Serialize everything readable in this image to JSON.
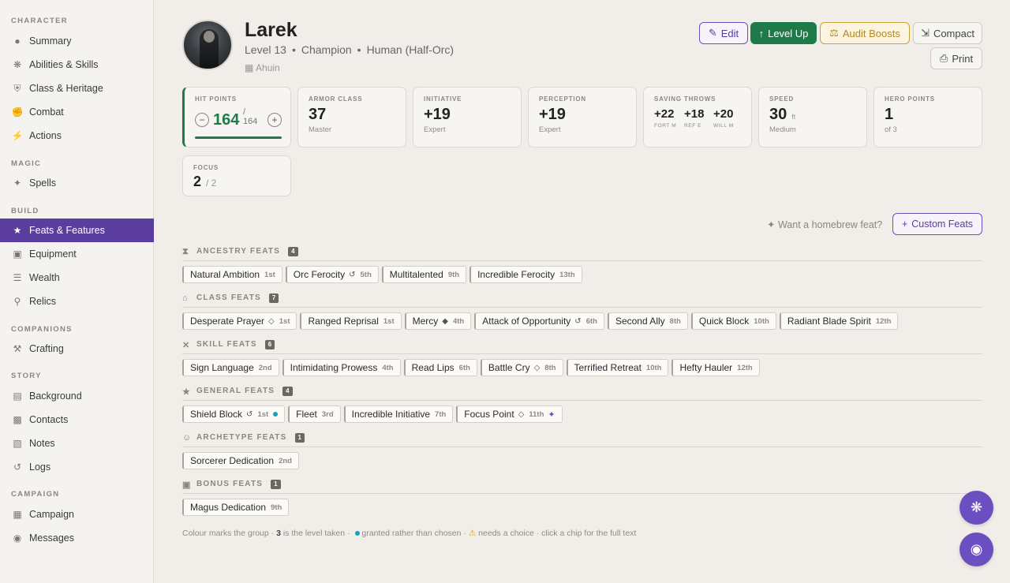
{
  "sidebar": {
    "sections": {
      "character": "CHARACTER",
      "magic": "MAGIC",
      "build": "BUILD",
      "companions": "COMPANIONS",
      "story": "STORY",
      "campaign": "CAMPAIGN"
    },
    "items": {
      "summary": "Summary",
      "abilities": "Abilities & Skills",
      "class": "Class & Heritage",
      "combat": "Combat",
      "actions": "Actions",
      "spells": "Spells",
      "feats": "Feats & Features",
      "equipment": "Equipment",
      "wealth": "Wealth",
      "relics": "Relics",
      "crafting": "Crafting",
      "background": "Background",
      "contacts": "Contacts",
      "notes": "Notes",
      "logs": "Logs",
      "campaign": "Campaign",
      "messages": "Messages"
    },
    "active_color": "#5b3d9e"
  },
  "header": {
    "name": "Larek",
    "level": "Level 13",
    "class": "Champion",
    "ancestry": "Human (Half-Orc)",
    "owner": "Ahuin",
    "buttons": {
      "edit": "Edit",
      "level_up": "Level Up",
      "audit": "Audit Boosts",
      "compact": "Compact",
      "print": "Print"
    }
  },
  "stats": {
    "hp": {
      "label": "HIT POINTS",
      "current": "164",
      "max": "164",
      "minus": "−",
      "plus": "+"
    },
    "ac": {
      "label": "ARMOR CLASS",
      "value": "37",
      "sub": "Master"
    },
    "initiative": {
      "label": "INITIATIVE",
      "value": "+19",
      "sub": "Expert"
    },
    "perception": {
      "label": "PERCEPTION",
      "value": "+19",
      "sub": "Expert"
    },
    "saves": {
      "label": "SAVING THROWS",
      "fort": {
        "value": "+22",
        "label": "FORT M"
      },
      "ref": {
        "value": "+18",
        "label": "REF E"
      },
      "will": {
        "value": "+20",
        "label": "WILL M"
      }
    },
    "speed": {
      "label": "SPEED",
      "value": "30",
      "unit": "ft",
      "sub": "Medium"
    },
    "hero": {
      "label": "HERO POINTS",
      "value": "1",
      "sub": "of 3"
    },
    "focus": {
      "label": "FOCUS",
      "value": "2",
      "max": "/ 2"
    }
  },
  "homebrew": {
    "prompt": "Want a homebrew feat?",
    "button": "Custom Feats"
  },
  "feat_groups": [
    {
      "title": "ANCESTRY FEATS",
      "count": "4",
      "feats": [
        {
          "name": "Natural Ambition",
          "level": "1st"
        },
        {
          "name": "Orc Ferocity",
          "level": "5th",
          "action": "↺"
        },
        {
          "name": "Multitalented",
          "level": "9th"
        },
        {
          "name": "Incredible Ferocity",
          "level": "13th"
        }
      ]
    },
    {
      "title": "CLASS FEATS",
      "count": "7",
      "feats": [
        {
          "name": "Desperate Prayer",
          "level": "1st",
          "action": "◇"
        },
        {
          "name": "Ranged Reprisal",
          "level": "1st"
        },
        {
          "name": "Mercy",
          "level": "4th",
          "action": "◆"
        },
        {
          "name": "Attack of Opportunity",
          "level": "6th",
          "action": "↺"
        },
        {
          "name": "Second Ally",
          "level": "8th"
        },
        {
          "name": "Quick Block",
          "level": "10th"
        },
        {
          "name": "Radiant Blade Spirit",
          "level": "12th"
        }
      ]
    },
    {
      "title": "SKILL FEATS",
      "count": "6",
      "feats": [
        {
          "name": "Sign Language",
          "level": "2nd"
        },
        {
          "name": "Intimidating Prowess",
          "level": "4th"
        },
        {
          "name": "Read Lips",
          "level": "6th"
        },
        {
          "name": "Battle Cry",
          "level": "8th",
          "action": "◇"
        },
        {
          "name": "Terrified Retreat",
          "level": "10th"
        },
        {
          "name": "Hefty Hauler",
          "level": "12th"
        }
      ]
    },
    {
      "title": "GENERAL FEATS",
      "count": "4",
      "feats": [
        {
          "name": "Shield Block",
          "level": "1st",
          "action": "↺",
          "granted": true
        },
        {
          "name": "Fleet",
          "level": "3rd"
        },
        {
          "name": "Incredible Initiative",
          "level": "7th"
        },
        {
          "name": "Focus Point",
          "level": "11th",
          "action": "◇",
          "wand": true
        }
      ]
    },
    {
      "title": "ARCHETYPE FEATS",
      "count": "1",
      "feats": [
        {
          "name": "Sorcerer Dedication",
          "level": "2nd"
        }
      ]
    },
    {
      "title": "BONUS FEATS",
      "count": "1",
      "feats": [
        {
          "name": "Magus Dedication",
          "level": "9th"
        }
      ]
    }
  ],
  "legend": {
    "part1": "Colour marks the group ·",
    "num": "3",
    "part2": "is the level taken ·",
    "part3": "granted rather than chosen ·",
    "part4": "needs a choice · click a chip for the full text"
  },
  "colors": {
    "accent": "#6b4fc0",
    "hp_green": "#1f7a49",
    "audit_gold": "#c9a33a",
    "granted_dot": "#18a0b8"
  }
}
